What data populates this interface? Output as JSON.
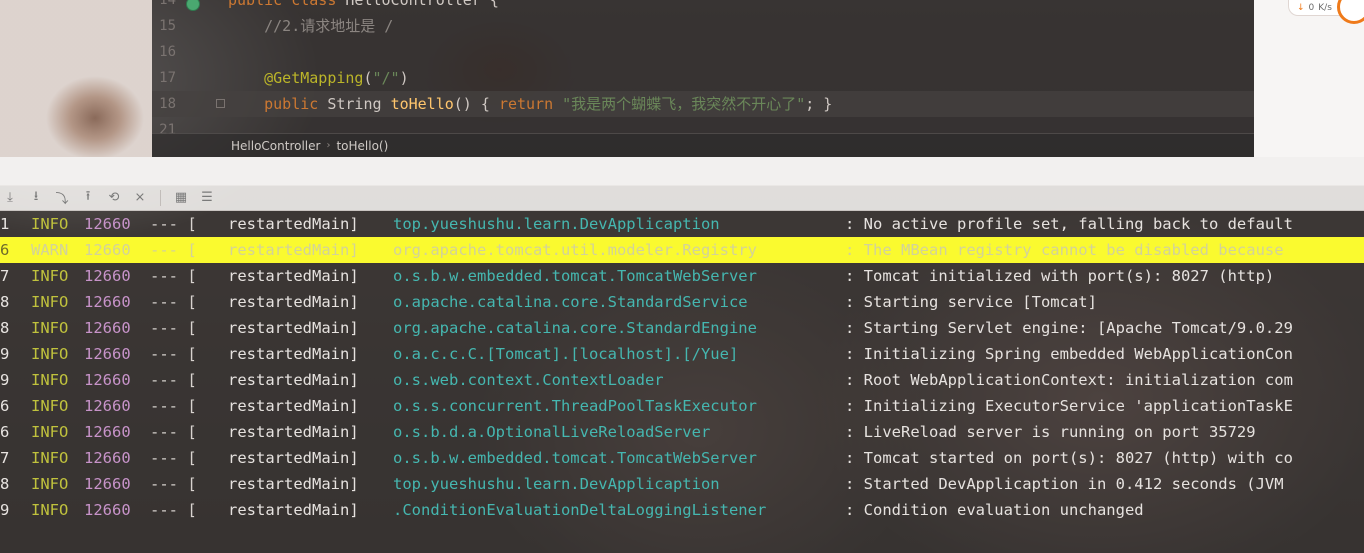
{
  "editor": {
    "lines": [
      {
        "num": "14",
        "parts": [
          {
            "t": "public class ",
            "c": "kw"
          },
          {
            "t": "HelloController {",
            "c": "pl"
          }
        ]
      },
      {
        "num": "15",
        "parts": [
          {
            "t": "    //2.请求地址是 /",
            "c": "cm"
          }
        ]
      },
      {
        "num": "16",
        "parts": []
      },
      {
        "num": "17",
        "parts": [
          {
            "t": "    @GetMapping",
            "c": "an"
          },
          {
            "t": "(",
            "c": "pl"
          },
          {
            "t": "\"/\"",
            "c": "st"
          },
          {
            "t": ")",
            "c": "pl"
          }
        ]
      },
      {
        "num": "18",
        "parts": [
          {
            "t": "    public ",
            "c": "kw"
          },
          {
            "t": "String ",
            "c": "pl"
          },
          {
            "t": "toHello",
            "c": "fn"
          },
          {
            "t": "() { ",
            "c": "pl"
          },
          {
            "t": "return ",
            "c": "kw"
          },
          {
            "t": "\"我是两个蝴蝶飞，我突然不开心了\"",
            "c": "st"
          },
          {
            "t": "; }",
            "c": "pl"
          }
        ]
      },
      {
        "num": "21",
        "parts": []
      }
    ],
    "breadcrumb": [
      "HelloController",
      "toHello()"
    ]
  },
  "net_widget": {
    "arrow": "↓",
    "value": "0",
    "unit": "K/s"
  },
  "toolbar": {
    "icons": [
      "scroll-to-end-icon",
      "download-icon",
      "soft-wrap-icon",
      "upload-icon",
      "restore-icon",
      "clear-icon",
      "print-icon",
      "settings-icon"
    ]
  },
  "console": {
    "rows": [
      {
        "idx": "1",
        "level": "INFO",
        "pid": "12660",
        "dash": "--- [",
        "thread": "restartedMain]",
        "logger": "top.yueshushu.learn.DevApplicaption",
        "msg": ": No active profile set, falling back to default"
      },
      {
        "idx": "6",
        "level": "WARN",
        "pid": "12660",
        "dash": "--- [",
        "thread": "restartedMain]",
        "logger": "org.apache.tomcat.util.modeler.Registry",
        "msg": ": The MBean registry cannot be disabled because",
        "warn": true
      },
      {
        "idx": "7",
        "level": "INFO",
        "pid": "12660",
        "dash": "--- [",
        "thread": "restartedMain]",
        "logger": "o.s.b.w.embedded.tomcat.TomcatWebServer",
        "msg": ": Tomcat initialized with port(s): 8027 (http)"
      },
      {
        "idx": "8",
        "level": "INFO",
        "pid": "12660",
        "dash": "--- [",
        "thread": "restartedMain]",
        "logger": "o.apache.catalina.core.StandardService",
        "msg": ": Starting service [Tomcat]"
      },
      {
        "idx": "8",
        "level": "INFO",
        "pid": "12660",
        "dash": "--- [",
        "thread": "restartedMain]",
        "logger": "org.apache.catalina.core.StandardEngine",
        "msg": ": Starting Servlet engine: [Apache Tomcat/9.0.29"
      },
      {
        "idx": "9",
        "level": "INFO",
        "pid": "12660",
        "dash": "--- [",
        "thread": "restartedMain]",
        "logger": "o.a.c.c.C.[Tomcat].[localhost].[/Yue]",
        "msg": ": Initializing Spring embedded WebApplicationCon"
      },
      {
        "idx": "9",
        "level": "INFO",
        "pid": "12660",
        "dash": "--- [",
        "thread": "restartedMain]",
        "logger": "o.s.web.context.ContextLoader",
        "msg": ": Root WebApplicationContext: initialization com"
      },
      {
        "idx": "6",
        "level": "INFO",
        "pid": "12660",
        "dash": "--- [",
        "thread": "restartedMain]",
        "logger": "o.s.s.concurrent.ThreadPoolTaskExecutor",
        "msg": ": Initializing ExecutorService 'applicationTaskE"
      },
      {
        "idx": "6",
        "level": "INFO",
        "pid": "12660",
        "dash": "--- [",
        "thread": "restartedMain]",
        "logger": "o.s.b.d.a.OptionalLiveReloadServer",
        "msg": ": LiveReload server is running on port 35729"
      },
      {
        "idx": "7",
        "level": "INFO",
        "pid": "12660",
        "dash": "--- [",
        "thread": "restartedMain]",
        "logger": "o.s.b.w.embedded.tomcat.TomcatWebServer",
        "msg": ": Tomcat started on port(s): 8027 (http) with co"
      },
      {
        "idx": "8",
        "level": "INFO",
        "pid": "12660",
        "dash": "--- [",
        "thread": "restartedMain]",
        "logger": "top.yueshushu.learn.DevApplicaption",
        "msg": ": Started DevApplicaption in 0.412 seconds (JVM"
      },
      {
        "idx": "9",
        "level": "INFO",
        "pid": "12660",
        "dash": "--- [",
        "thread": "restartedMain]",
        "logger": ".ConditionEvaluationDeltaLoggingListener",
        "msg": ": Condition evaluation unchanged"
      }
    ]
  }
}
